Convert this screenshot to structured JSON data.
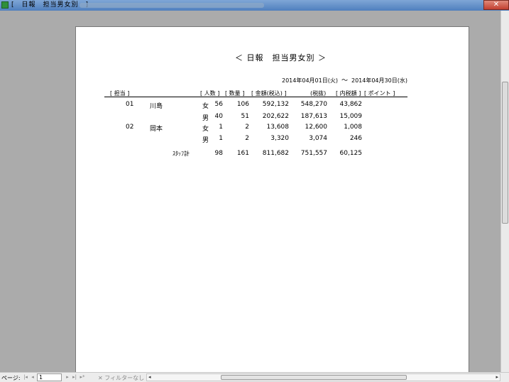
{
  "window": {
    "title": "[　日報　担当男女別　]"
  },
  "report": {
    "title": "＜ 日報　担当男女別 ＞",
    "date_from": "2014年04月01日(火)",
    "date_sep": "～",
    "date_to": "2014年04月30日(水)",
    "headers": {
      "staff": "[ 担当 ]",
      "count": "[ 人数 ]",
      "qty": "[ 数量 ]",
      "amount": "[ 金額(税込) ]",
      "excl": "(税抜)",
      "tax": "[ 内税額 ]",
      "point": "[ ポイント ]"
    },
    "rows": [
      {
        "code": "01",
        "name": "川島",
        "gender": "女",
        "count": "56",
        "qty": "106",
        "amount": "592,132",
        "excl": "548,270",
        "tax": "43,862"
      },
      {
        "code": "",
        "name": "",
        "gender": "男",
        "count": "40",
        "qty": "51",
        "amount": "202,622",
        "excl": "187,613",
        "tax": "15,009"
      },
      {
        "code": "02",
        "name": "岡本",
        "gender": "女",
        "count": "1",
        "qty": "2",
        "amount": "13,608",
        "excl": "12,600",
        "tax": "1,008"
      },
      {
        "code": "",
        "name": "",
        "gender": "男",
        "count": "1",
        "qty": "2",
        "amount": "3,320",
        "excl": "3,074",
        "tax": "246"
      }
    ],
    "total": {
      "label": "ｽﾀｯﾌ計",
      "count": "98",
      "qty": "161",
      "amount": "811,682",
      "excl": "751,557",
      "tax": "60,125"
    }
  },
  "statusbar": {
    "page_label": "ページ:",
    "page_value": "1",
    "filter": "フィルターなし"
  }
}
